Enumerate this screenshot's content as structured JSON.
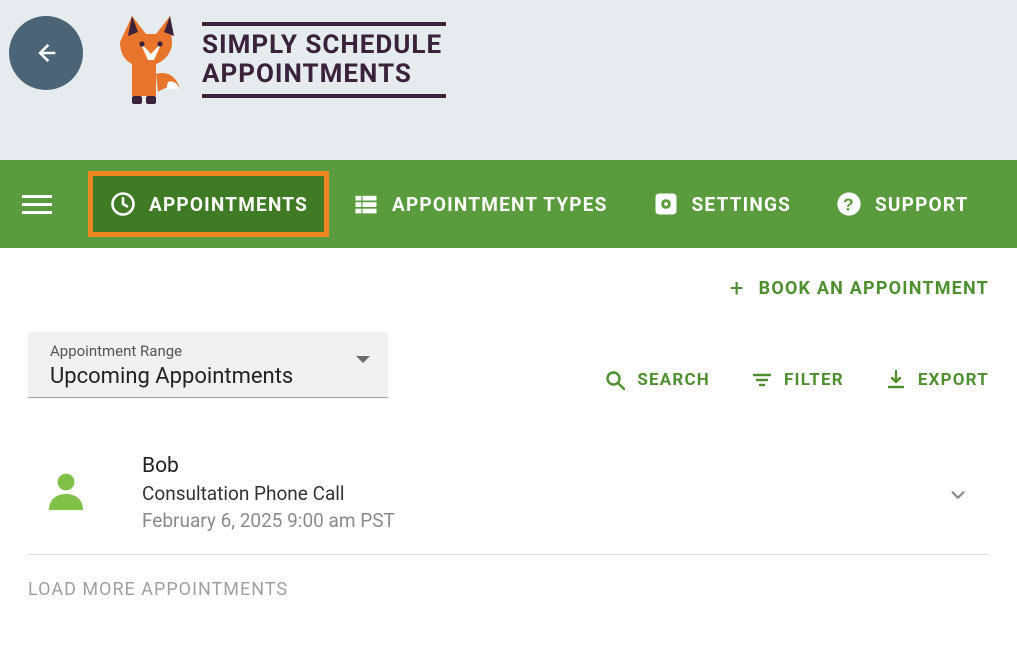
{
  "colors": {
    "nav_bg": "#5a9b3e",
    "nav_active_bg": "#3e7b24",
    "highlight_border": "#ed8522",
    "action_green": "#4e8f2f",
    "back_btn_bg": "#4b6476"
  },
  "logo": {
    "line1": "SIMPLY SCHEDULE",
    "line2": "APPOINTMENTS"
  },
  "nav": {
    "items": [
      {
        "label": "APPOINTMENTS",
        "icon": "clock-icon",
        "active": true
      },
      {
        "label": "APPOINTMENT TYPES",
        "icon": "list-icon",
        "active": false
      },
      {
        "label": "SETTINGS",
        "icon": "gear-icon",
        "active": false
      },
      {
        "label": "SUPPORT",
        "icon": "help-icon",
        "active": false
      }
    ]
  },
  "book_button": "BOOK AN APPOINTMENT",
  "range_select": {
    "label": "Appointment Range",
    "value": "Upcoming Appointments"
  },
  "actions": {
    "search": "SEARCH",
    "filter": "FILTER",
    "export": "EXPORT"
  },
  "appointments": [
    {
      "name": "Bob",
      "type": "Consultation Phone Call",
      "time": "February 6, 2025 9:00 am PST"
    }
  ],
  "load_more": "LOAD MORE APPOINTMENTS"
}
